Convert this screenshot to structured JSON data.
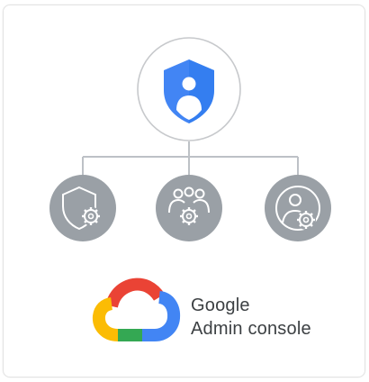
{
  "brand": {
    "line1": "Google",
    "line2": "Admin console"
  },
  "icons": {
    "top": "admin-shield-user-icon",
    "children": [
      "security-settings-icon",
      "group-settings-icon",
      "user-settings-icon"
    ],
    "logo": "google-cloud-logo"
  },
  "colors": {
    "shield_blue": "#4285f4",
    "node_gray": "#9aa0a6",
    "line_gray": "#bdc1c6",
    "cloud_red": "#ea4335",
    "cloud_blue": "#4285f4",
    "cloud_green": "#34a853",
    "cloud_yellow": "#fbbc04"
  }
}
